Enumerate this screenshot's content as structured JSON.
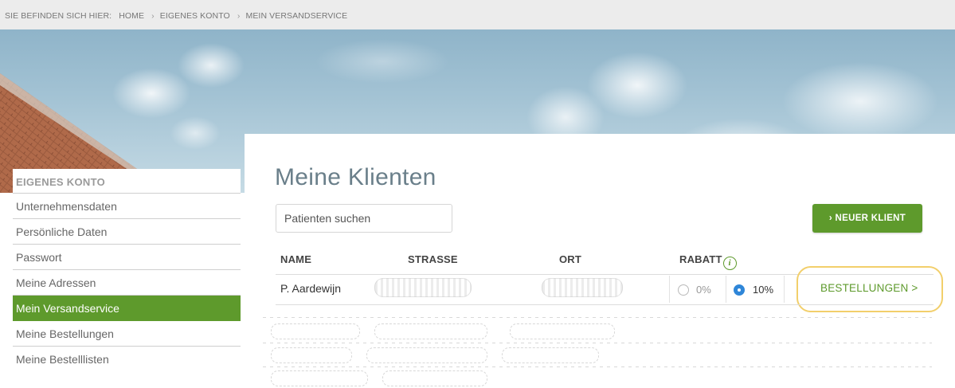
{
  "breadcrumb": {
    "prefix": "SIE BEFINDEN SICH HIER:",
    "separator": "›",
    "items": [
      "HOME",
      "EIGENES KONTO",
      "MEIN VERSANDSERVICE"
    ]
  },
  "sidebar": {
    "title": "EIGENES KONTO",
    "items": [
      {
        "label": "Unternehmensdaten",
        "active": false
      },
      {
        "label": "Persönliche Daten",
        "active": false
      },
      {
        "label": "Passwort",
        "active": false
      },
      {
        "label": "Meine Adressen",
        "active": false
      },
      {
        "label": "Mein Versandservice",
        "active": true
      },
      {
        "label": "Meine Bestellungen",
        "active": false
      },
      {
        "label": "Meine Bestelllisten",
        "active": false
      }
    ]
  },
  "main": {
    "title": "Meine Klienten",
    "search": {
      "placeholder": "Patienten suchen",
      "value": ""
    },
    "new_client_label": "› NEUER KLIENT",
    "table": {
      "columns": [
        "NAME",
        "STRASSE",
        "ORT",
        "RABATT"
      ],
      "info_icon_glyph": "i",
      "rows": [
        {
          "name": "P. Aardewijn",
          "strasse": "",
          "ort": "",
          "rabatt_options": [
            "0%",
            "10%"
          ],
          "rabatt_selected": "10%",
          "orders_label": "BESTELLUNGEN >"
        }
      ]
    }
  },
  "colors": {
    "brand_green": "#5e9a2c",
    "radio_blue": "#2f86d8",
    "highlight": "#f2cf6b",
    "title_gray_blue": "#6a7f8a"
  }
}
